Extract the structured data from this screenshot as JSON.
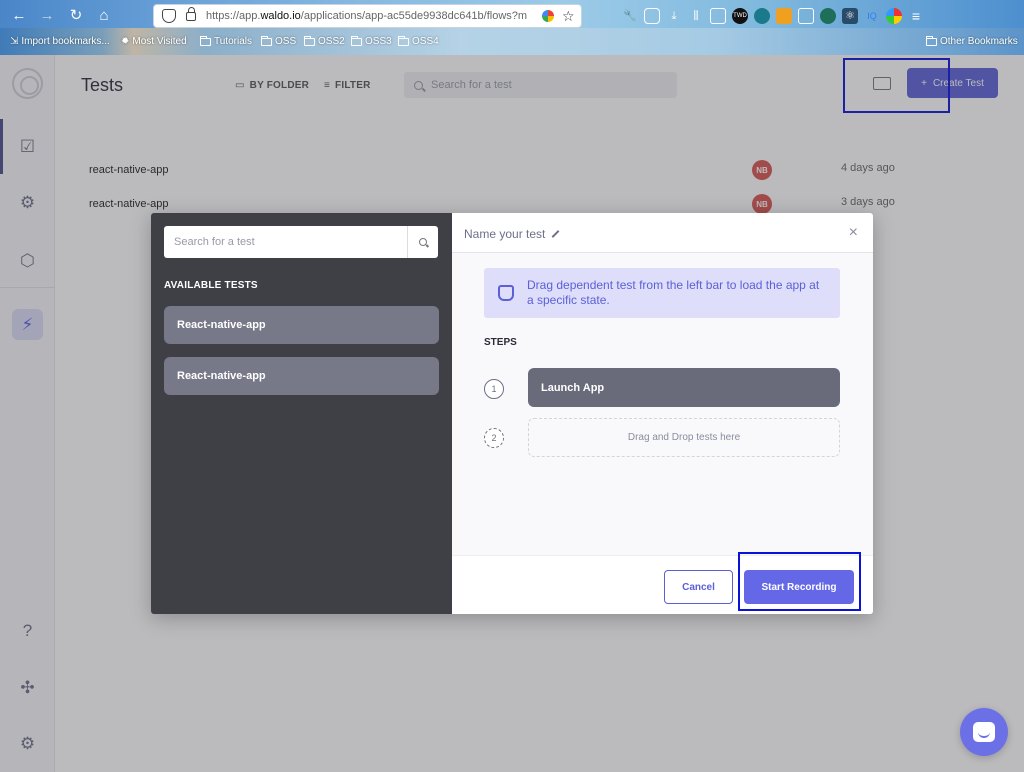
{
  "browser": {
    "url_prefix": "https://app.",
    "url_host": "waldo.io",
    "url_rest": "/applications/app-ac55de9938dc641b/flows?m",
    "bookmarks": [
      {
        "label": "Import bookmarks..."
      },
      {
        "label": "Most Visited"
      },
      {
        "label": "Tutorials"
      },
      {
        "label": "OSS"
      },
      {
        "label": "OSS2"
      },
      {
        "label": "OSS3"
      },
      {
        "label": "OSS4"
      },
      {
        "label": "Other Bookmarks"
      }
    ]
  },
  "header": {
    "title": "Tests",
    "by_folder": "BY FOLDER",
    "filter": "FILTER",
    "search_placeholder": "Search for a test",
    "create_label": "Create Test"
  },
  "tests": [
    {
      "name": "react-native-app",
      "initials": "NB",
      "time": "4 days ago"
    },
    {
      "name": "react-native-app",
      "initials": "NB",
      "time": "3 days ago"
    }
  ],
  "modal": {
    "search_placeholder": "Search for a test",
    "available_heading": "AVAILABLE TESTS",
    "available": [
      {
        "label": "React-native-app"
      },
      {
        "label": "React-native-app"
      }
    ],
    "name_placeholder": "Name your test",
    "info": "Drag dependent test from the left bar to load the app at a specific state.",
    "steps_heading": "STEPS",
    "steps": [
      {
        "num": "1",
        "label": "Launch App"
      },
      {
        "num": "2",
        "label": "Drag and Drop tests here"
      }
    ],
    "cancel": "Cancel",
    "start_recording": "Start Recording"
  },
  "colors": {
    "accent": "#5c60d6",
    "highlight": "#0b12d8",
    "modal_left_bg": "#3f4046",
    "avatar": "#d9534f"
  }
}
